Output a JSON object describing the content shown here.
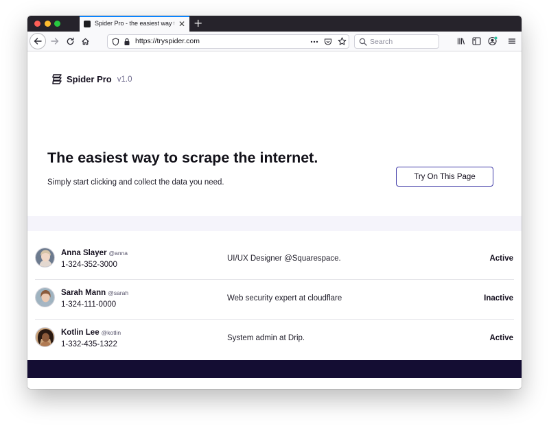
{
  "browser": {
    "tab_title": "Spider Pro - the easiest way to",
    "tab_close": "✕",
    "new_tab": "+",
    "url": "https://tryspider.com",
    "search_placeholder": "Search"
  },
  "brand": {
    "name": "Spider Pro",
    "version": "v1.0"
  },
  "hero": {
    "headline": "The easiest way to scrape the internet.",
    "subline": "Simply start clicking and collect the data you need.",
    "cta_label": "Try On This Page"
  },
  "users": [
    {
      "name": "Anna Slayer",
      "handle": "@anna",
      "phone": "1-324-352-3000",
      "role": "UI/UX Designer @Squarespace.",
      "status": "Active"
    },
    {
      "name": "Sarah Mann",
      "handle": "@sarah",
      "phone": "1-324-111-0000",
      "role": "Web security expert at cloudflare",
      "status": "Inactive"
    },
    {
      "name": "Kotlin Lee",
      "handle": "@kotlin",
      "phone": "1-332-435-1322",
      "role": "System admin at Drip.",
      "status": "Active"
    }
  ],
  "colors": {
    "accent": "#3d38a6",
    "footer": "#140d33",
    "band": "#f5f4fb",
    "tab_highlight": "#0a84ff"
  }
}
